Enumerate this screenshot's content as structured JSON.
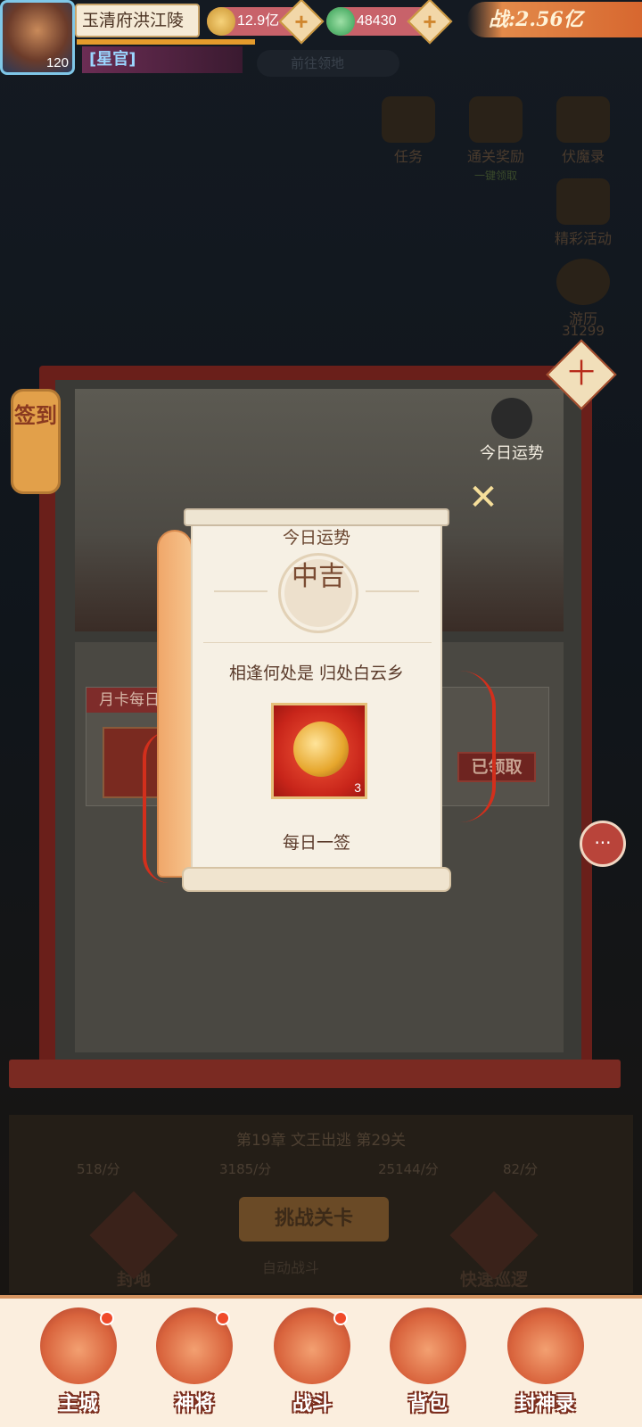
{
  "header": {
    "player_name": "玉清府洪江陵",
    "level": "120",
    "title_badge": "[星官]",
    "gold": "12.9亿",
    "jade": "48430",
    "power": "战:2.56亿",
    "search_placeholder": "前往领地",
    "plus_label": "+"
  },
  "side_menu": {
    "items": [
      {
        "label": "任务"
      },
      {
        "label": "通关奖励",
        "sub": "一键领取"
      },
      {
        "label": "伏魔录"
      },
      {
        "label": "精彩活动"
      },
      {
        "label": "游历"
      }
    ],
    "counter": "31299"
  },
  "signin": {
    "lantern_label": "签到",
    "daily_fortune_badge": "今日运势",
    "card_tag": "月卡每日",
    "card_claimed": "已领取",
    "corner_seal": "十"
  },
  "modal": {
    "title": "今日运势",
    "fortune": "中吉",
    "poem": "相逢何处是  归处白云乡",
    "reward": {
      "icon": "golden-ruyi-icon",
      "quantity": "3"
    },
    "caption": "每日一签",
    "close_symbol": "✕"
  },
  "stage": {
    "chapter": "第19章 文王出逃 第29关",
    "resources": [
      "518/分",
      "3185/分",
      "25144/分",
      "82/分"
    ],
    "challenge_button": "挑战关卡",
    "auto_battle": "自动战斗",
    "left_button": "封地",
    "right_button": "快速巡逻"
  },
  "bottom_nav": {
    "items": [
      {
        "label": "主城",
        "badge": true
      },
      {
        "label": "神将",
        "badge": true
      },
      {
        "label": "战斗",
        "badge": true
      },
      {
        "label": "背包",
        "badge": false
      },
      {
        "label": "封神录",
        "badge": false
      }
    ]
  },
  "chat": {
    "icon": "chat-bubble-icon",
    "symbol": "···"
  },
  "colors": {
    "frame_red": "#6a1f1a",
    "scroll_paper": "#f6f0e4",
    "accent_orange": "#d7672f",
    "reward_red": "#c8251a"
  }
}
